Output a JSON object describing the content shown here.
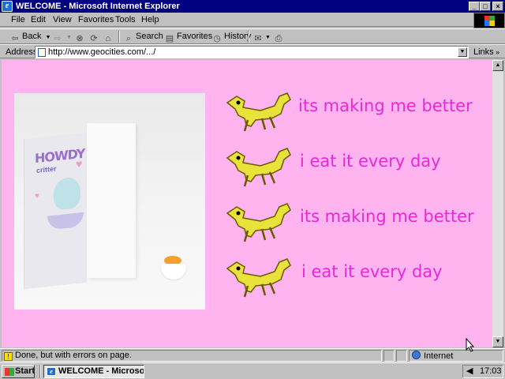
{
  "window": {
    "title": "WELCOME - Microsoft Internet Explorer",
    "icon": "ie-icon",
    "controls": [
      "minimize-icon",
      "maximize-icon",
      "close-icon"
    ]
  },
  "menu": {
    "items": [
      {
        "label": "File"
      },
      {
        "label": "Edit"
      },
      {
        "label": "View"
      },
      {
        "label": "Favorites"
      },
      {
        "label": "Tools"
      },
      {
        "label": "Help"
      }
    ]
  },
  "toolbar": {
    "back": "Back",
    "search": "Search",
    "favorites": "Favorites",
    "history": "History"
  },
  "address": {
    "label": "Address",
    "url": "http://www.geocities.com/.../",
    "links": "Links"
  },
  "page": {
    "background": "#ffb3ef",
    "caption_color": "#e829d6",
    "photo_text": {
      "brand": "HOWDY",
      "brand_sub": "critter"
    },
    "rows": [
      {
        "caption": "its making me better"
      },
      {
        "caption": "i eat it every day"
      },
      {
        "caption": "its making me better"
      },
      {
        "caption": "i eat it every day"
      }
    ]
  },
  "status": {
    "text": "Done, but with errors on page.",
    "zone": "Internet"
  },
  "taskbar": {
    "start": "Start",
    "task": "WELCOME - Microsof...",
    "clock": "17:03"
  }
}
